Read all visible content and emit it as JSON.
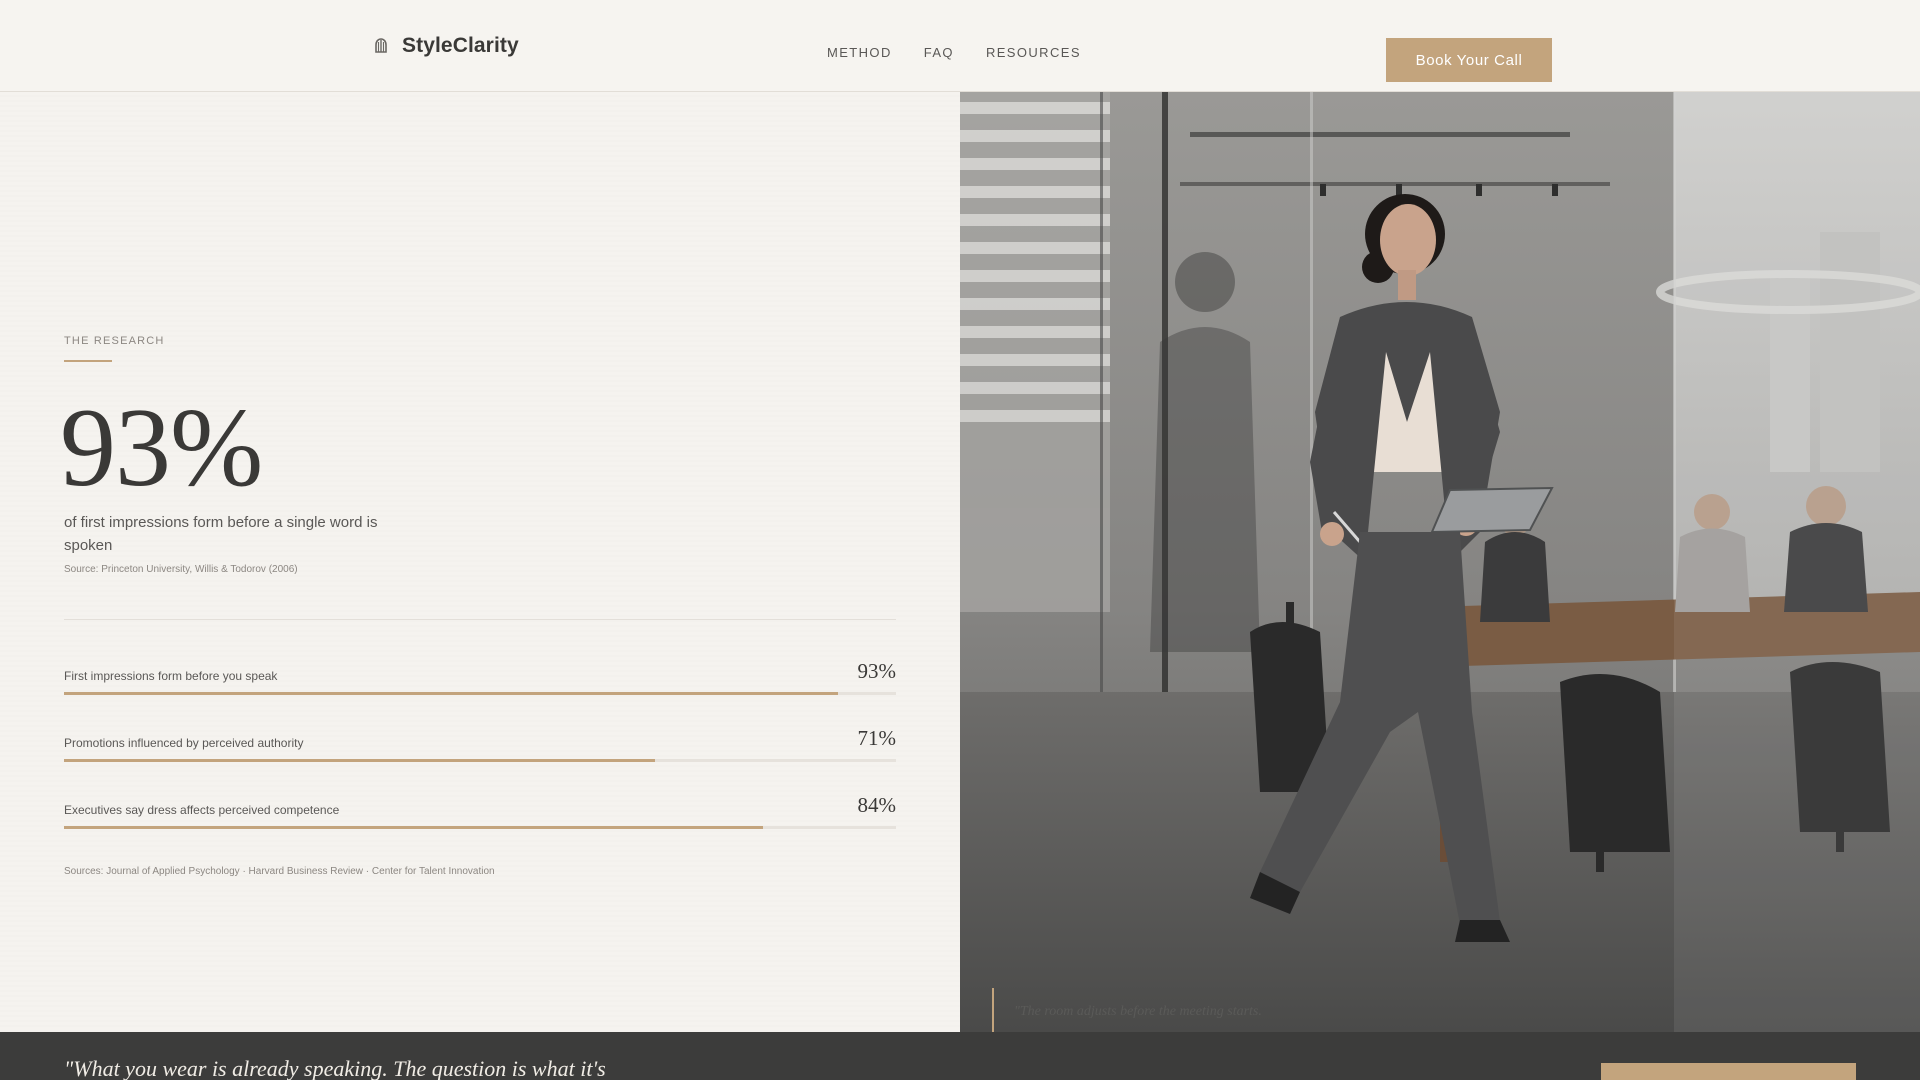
{
  "header": {
    "brand": "StyleClarity",
    "nav": [
      "METHOD",
      "FAQ",
      "RESOURCES"
    ],
    "cta": "Book Your Call",
    "logo_icon": "hanger-icon"
  },
  "research": {
    "eyebrow": "THE RESEARCH",
    "big_stat": "93%",
    "big_desc": "of first impressions form before a single word is spoken",
    "big_source": "Source: Princeton University, Willis & Todorov (2006)",
    "stats": [
      {
        "label": "First impressions form before you speak",
        "value": "93%",
        "fraction": 0.93
      },
      {
        "label": "Promotions influenced by perceived authority",
        "value": "71%",
        "fraction": 0.71
      },
      {
        "label": "Executives say dress affects perceived competence",
        "value": "84%",
        "fraction": 0.84
      }
    ],
    "sources": "Sources: Journal of Applied Psychology · Harvard Business Review · Center for Talent Innovation"
  },
  "photo": {
    "caption": "\"The room adjusts before the meeting starts."
  },
  "band": {
    "quote": "\"What you wear is already speaking. The question is what it's"
  },
  "colors": {
    "accent": "#c3a47d",
    "background": "#f5f3ef",
    "text": "#3a3937",
    "band": "#3c3c3b"
  }
}
